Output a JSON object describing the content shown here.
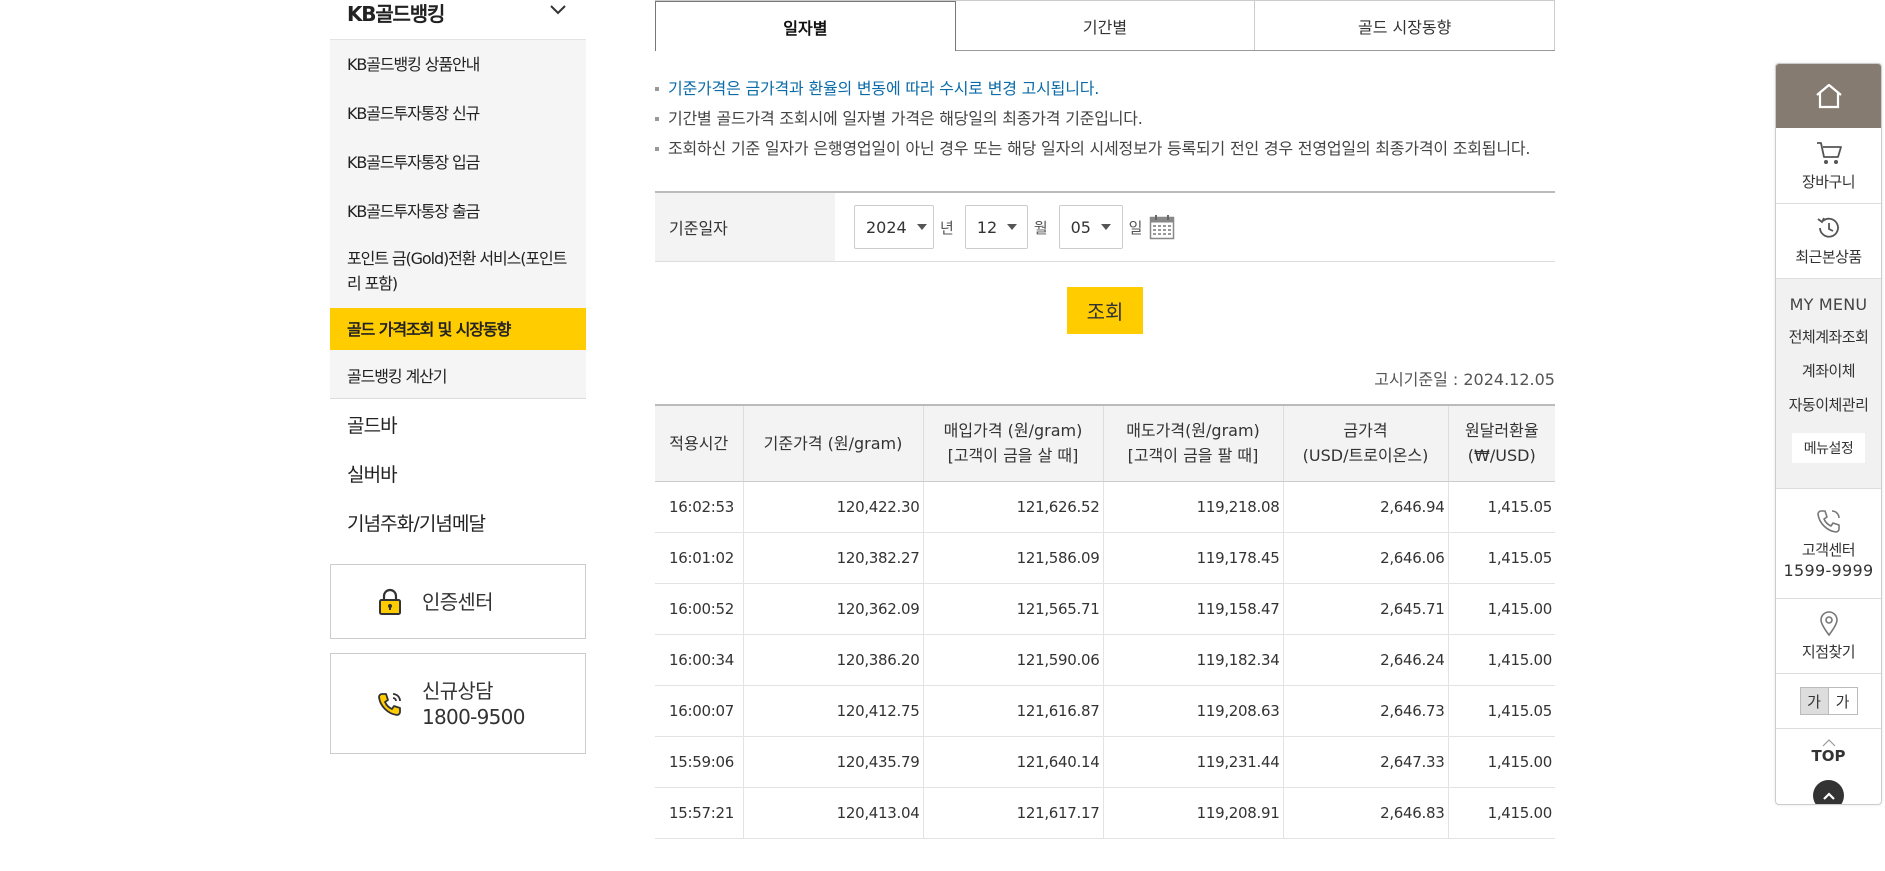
{
  "sidebar": {
    "header_title": "KB골드뱅킹",
    "items": [
      {
        "label": "KB골드뱅킹 상품안내"
      },
      {
        "label": "KB골드투자통장 신규"
      },
      {
        "label": "KB골드투자통장 입금"
      },
      {
        "label": "KB골드투자통장 출금"
      },
      {
        "label": "포인트 금(Gold)전환 서비스(포인트리 포함)"
      },
      {
        "label": "골드 가격조회 및 시장동향"
      },
      {
        "label": "골드뱅킹 계산기"
      }
    ],
    "categories": [
      {
        "label": "골드바"
      },
      {
        "label": "실버바"
      },
      {
        "label": "기념주화/기념메달"
      }
    ],
    "auth_center": "인증센터",
    "consult_label": "신규상담",
    "consult_phone": "1800-9500"
  },
  "tabs": [
    {
      "label": "일자별",
      "active": true
    },
    {
      "label": "기간별",
      "active": false
    },
    {
      "label": "골드 시장동향",
      "active": false
    }
  ],
  "notes": [
    "기준가격은 금가격과 환율의 변동에 따라 수시로 변경 고시됩니다.",
    "기간별 골드가격 조회시에 일자별 가격은 해당일의 최종가격 기준입니다.",
    "조회하신 기준 일자가 은행영업일이 아닌 경우 또는 해당 일자의 시세정보가 등록되기 전인 경우 전영업일의 최종가격이 조회됩니다."
  ],
  "search": {
    "label": "기준일자",
    "year": "2024",
    "year_unit": "년",
    "month": "12",
    "month_unit": "월",
    "day": "05",
    "day_unit": "일",
    "button": "조회"
  },
  "notice_date": "고시기준일 : 2024.12.05",
  "table": {
    "headers": [
      [
        "적용시간"
      ],
      [
        "기준가격 (원/gram)"
      ],
      [
        "매입가격 (원/gram)",
        "[고객이 금을 살 때]"
      ],
      [
        "매도가격(원/gram)",
        "[고객이 금을 팔 때]"
      ],
      [
        "금가격",
        "(USD/트로이온스)"
      ],
      [
        "원달러환율",
        "(₩/USD)"
      ]
    ],
    "rows": [
      [
        "16:02:53",
        "120,422.30",
        "121,626.52",
        "119,218.08",
        "2,646.94",
        "1,415.05"
      ],
      [
        "16:01:02",
        "120,382.27",
        "121,586.09",
        "119,178.45",
        "2,646.06",
        "1,415.05"
      ],
      [
        "16:00:52",
        "120,362.09",
        "121,565.71",
        "119,158.47",
        "2,645.71",
        "1,415.00"
      ],
      [
        "16:00:34",
        "120,386.20",
        "121,590.06",
        "119,182.34",
        "2,646.24",
        "1,415.00"
      ],
      [
        "16:00:07",
        "120,412.75",
        "121,616.87",
        "119,208.63",
        "2,646.73",
        "1,415.05"
      ],
      [
        "15:59:06",
        "120,435.79",
        "121,640.14",
        "119,231.44",
        "2,647.33",
        "1,415.00"
      ],
      [
        "15:57:21",
        "120,413.04",
        "121,617.17",
        "119,208.91",
        "2,646.83",
        "1,415.00"
      ]
    ]
  },
  "quick": {
    "cart": "장바구니",
    "recent": "최근본상품",
    "mymenu_title": "MY MENU",
    "mymenu_links": [
      "전체계좌조회",
      "계좌이체",
      "자동이체관리"
    ],
    "mymenu_setting": "메뉴설정",
    "call_label": "고객센터",
    "call_number": "1599-9999",
    "branch": "지점찾기",
    "font_small": "가",
    "font_large": "가",
    "top": "TOP"
  },
  "colors": {
    "accent": "#ffcc00",
    "home_bg": "#857b70",
    "note_blue": "#0b6ba8"
  }
}
